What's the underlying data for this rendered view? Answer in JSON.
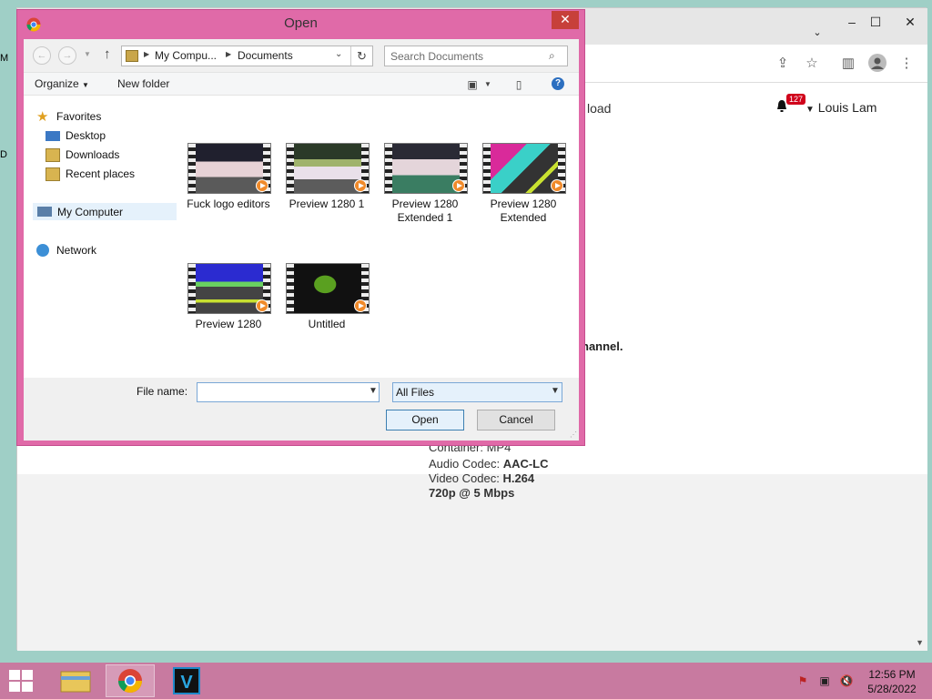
{
  "chrome": {
    "page_link_partial": "load",
    "notification_count": "127",
    "user_name": "Louis Lam",
    "channel_text_partial": "hannel.",
    "codec_partial_label": "Container: MP4",
    "audio_codec_label": "Audio Codec:",
    "audio_codec_value": "AAC-LC",
    "video_codec_label": "Video Codec:",
    "video_codec_value": "H.264",
    "quality": "720p @ 5 Mbps"
  },
  "dialog": {
    "title": "Open",
    "close_symbol": "✕",
    "address": {
      "segments": [
        "My Compu...",
        "Documents"
      ]
    },
    "search": {
      "placeholder": "Search Documents"
    },
    "toolbar": {
      "organize_label": "Organize",
      "new_folder_label": "New folder"
    },
    "nav": {
      "favorites": "Favorites",
      "desktop": "Desktop",
      "downloads": "Downloads",
      "recent_places": "Recent places",
      "my_computer": "My Computer",
      "network": "Network"
    },
    "files": [
      {
        "line1": "Fuck logo editors",
        "line2": ""
      },
      {
        "line1": "Preview 1280 1",
        "line2": ""
      },
      {
        "line1": "Preview 1280",
        "line2": "Extended 1"
      },
      {
        "line1": "Preview 1280",
        "line2": "Extended"
      },
      {
        "line1": "Preview 1280",
        "line2": ""
      },
      {
        "line1": "Untitled",
        "line2": ""
      }
    ],
    "file_name_label": "File name:",
    "file_name_value": "",
    "file_type": "All Files",
    "open_label": "Open",
    "cancel_label": "Cancel"
  },
  "taskbar": {
    "time": "12:56 PM",
    "date": "5/28/2022"
  },
  "colors": {
    "dialog_frame": "#e06aa8",
    "taskbar": "#c87aa0",
    "close_button": "#c7403a"
  }
}
